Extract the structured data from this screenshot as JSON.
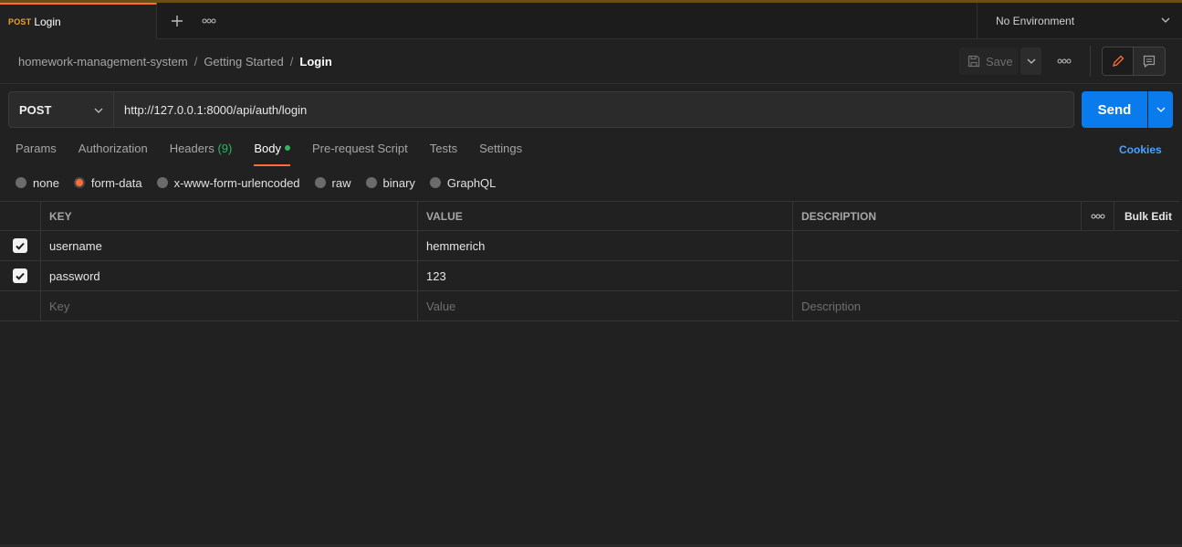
{
  "tab": {
    "method": "POST",
    "title": "Login"
  },
  "environment": {
    "label": "No Environment"
  },
  "breadcrumb": {
    "collection": "homework-management-system",
    "folder": "Getting Started",
    "request": "Login",
    "separator": "/"
  },
  "toolbar": {
    "save_label": "Save"
  },
  "request": {
    "method": "POST",
    "url": "http://127.0.0.1:8000/api/auth/login",
    "send_label": "Send"
  },
  "tabs": {
    "params": "Params",
    "authorization": "Authorization",
    "headers": "Headers",
    "headers_count": "(9)",
    "body": "Body",
    "prerequest": "Pre-request Script",
    "tests": "Tests",
    "settings": "Settings",
    "cookies": "Cookies"
  },
  "body_types": {
    "none": "none",
    "form_data": "form-data",
    "urlencoded": "x-www-form-urlencoded",
    "raw": "raw",
    "binary": "binary",
    "graphql": "GraphQL",
    "selected": "form-data"
  },
  "table": {
    "headers": {
      "key": "KEY",
      "value": "VALUE",
      "description": "DESCRIPTION",
      "bulk_edit": "Bulk Edit"
    },
    "rows": [
      {
        "key": "username",
        "value": "hemmerich",
        "description": "",
        "checked": true
      },
      {
        "key": "password",
        "value": "123",
        "description": "",
        "checked": true
      }
    ],
    "placeholders": {
      "key": "Key",
      "value": "Value",
      "description": "Description"
    }
  },
  "colors": {
    "accent": "#ff6c37",
    "send": "#097bed",
    "link": "#4aa3ff",
    "status_green": "#2fb760",
    "method_post": "#f0a028"
  },
  "icons": [
    "plus-icon",
    "more-icon",
    "chevron-down-icon",
    "save-icon",
    "pencil-icon",
    "comment-icon",
    "check-icon"
  ]
}
